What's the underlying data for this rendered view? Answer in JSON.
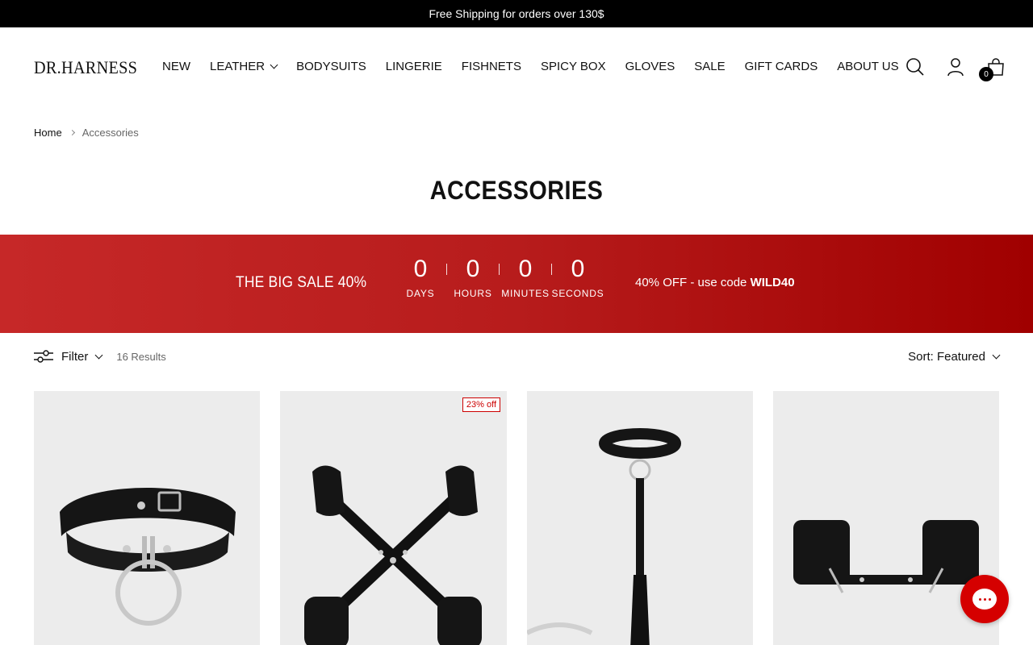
{
  "announcement": "Free Shipping for orders over 130$",
  "header": {
    "logo": "DR.HARNESS",
    "nav": [
      {
        "label": "NEW",
        "dropdown": false
      },
      {
        "label": "LEATHER",
        "dropdown": true
      },
      {
        "label": "BODYSUITS",
        "dropdown": false
      },
      {
        "label": "LINGERIE",
        "dropdown": false
      },
      {
        "label": "FISHNETS",
        "dropdown": false
      },
      {
        "label": "SPICY BOX",
        "dropdown": false
      },
      {
        "label": "GLOVES",
        "dropdown": false
      },
      {
        "label": "SALE",
        "dropdown": false
      },
      {
        "label": "GIFT CARDS",
        "dropdown": false
      },
      {
        "label": "ABOUT US",
        "dropdown": false
      }
    ],
    "icons": [
      "search-icon",
      "account-icon",
      "cart-icon"
    ],
    "cart_count": "0"
  },
  "breadcrumb": {
    "home": "Home",
    "current": "Accessories"
  },
  "page_title": "ACCESSORIES",
  "sale_banner": {
    "title": "THE BIG SALE 40%",
    "countdown": {
      "days": "0",
      "days_label": "DAYS",
      "hours": "0",
      "hours_label": "HOURS",
      "minutes": "0",
      "minutes_label": "MINUTES",
      "seconds": "0",
      "seconds_label": "SECONDS"
    },
    "code_text": "40% OFF - use code ",
    "code": "WILD40",
    "colors": {
      "start": "#c62828",
      "end": "#a00000"
    }
  },
  "toolbar": {
    "filter_label": "Filter",
    "results": "16 Results",
    "sort_label": "Sort: Featured"
  },
  "products": [
    {
      "badge": "",
      "image": "collar-with-o-ring"
    },
    {
      "badge": "23% off",
      "image": "hogtie-cross-restraint"
    },
    {
      "badge": "",
      "image": "collar-with-leash-flogger"
    },
    {
      "badge": "",
      "image": "wrist-cuffs"
    }
  ],
  "colors": {
    "accent": "#d50000",
    "badge": "#cc0000",
    "card_bg": "#ececec"
  }
}
